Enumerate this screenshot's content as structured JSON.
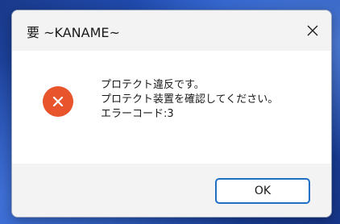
{
  "window": {
    "title": "要 ~KANAME~",
    "close_icon": "close-icon"
  },
  "message": {
    "icon": "error-icon",
    "icon_color": "#e8542b",
    "lines": [
      "プロテクト違反です。",
      "プロテクト装置を確認してください。",
      "エラーコード:3"
    ]
  },
  "buttons": {
    "ok_label": "OK",
    "accent_color": "#1f6fc5"
  }
}
